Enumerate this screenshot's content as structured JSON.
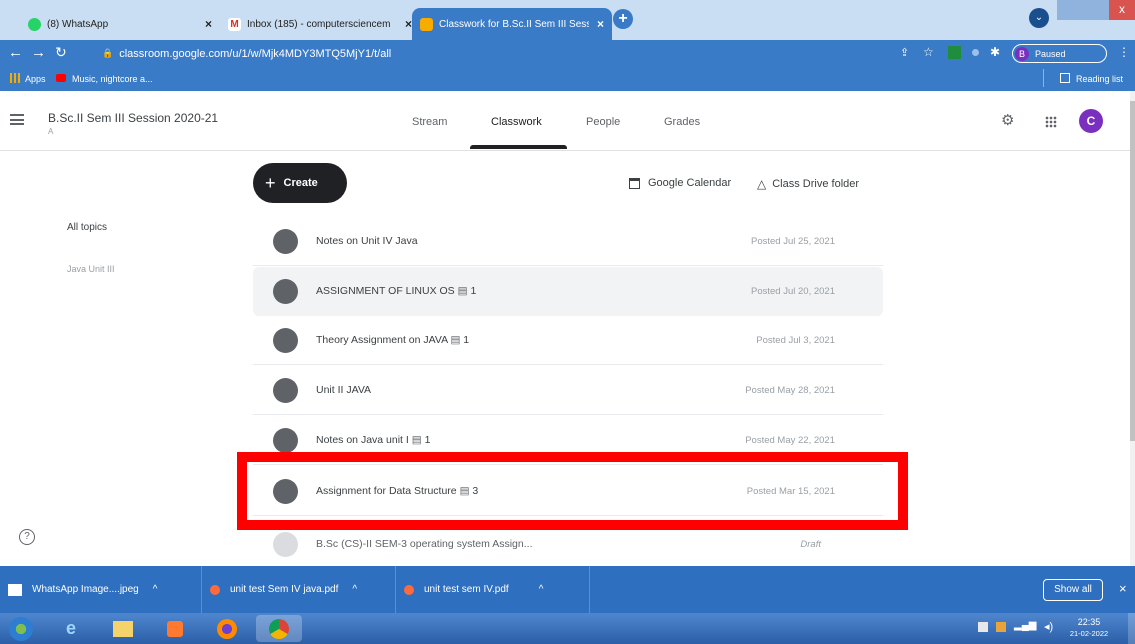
{
  "browser": {
    "tabs": [
      {
        "title": "(8) WhatsApp",
        "active": false
      },
      {
        "title": "Inbox (185) - computersciencem",
        "active": false
      },
      {
        "title": "Classwork for B.Sc.II Sem III Sess",
        "active": true
      }
    ],
    "url": "classroom.google.com/u/1/w/Mjk4MDY3MTQ5MjY1/t/all",
    "profile_label": "Paused",
    "profile_initial": "B",
    "bookmarks": [
      {
        "label": "Apps"
      },
      {
        "label": "Music, nightcore a..."
      }
    ],
    "reading_list": "Reading list"
  },
  "classroom": {
    "class_name": "B.Sc.II Sem III Session 2020-21",
    "section": "A",
    "nav_tabs": [
      "Stream",
      "Classwork",
      "People",
      "Grades"
    ],
    "active_tab": "Classwork",
    "avatar_initial": "C",
    "create_label": "Create",
    "google_calendar": "Google Calendar",
    "class_drive_folder": "Class Drive folder",
    "topics": [
      "All topics",
      "Java Unit III"
    ],
    "items": [
      {
        "title": "Notes on Unit IV Java",
        "comments": "",
        "posted": "Posted Jul 25, 2021",
        "kind": "material"
      },
      {
        "title": "ASSIGNMENT OF LINUX OS",
        "comments": "1",
        "posted": "Posted Jul 20, 2021",
        "kind": "assignment"
      },
      {
        "title": "Theory Assignment on JAVA",
        "comments": "1",
        "posted": "Posted Jul 3, 2021",
        "kind": "assignment"
      },
      {
        "title": "Unit II JAVA",
        "comments": "",
        "posted": "Posted May 28, 2021",
        "kind": "material"
      },
      {
        "title": "Notes on Java unit I",
        "comments": "1",
        "posted": "Posted May 22, 2021",
        "kind": "material"
      },
      {
        "title": "Assignment for Data Structure",
        "comments": "3",
        "posted": "Posted Mar 15, 2021",
        "kind": "assignment"
      },
      {
        "title": "B.Sc (CS)-II SEM-3 operating system Assign...",
        "comments": "",
        "posted": "Draft",
        "kind": "assignment"
      }
    ]
  },
  "downloads": [
    {
      "name": "WhatsApp Image....jpeg"
    },
    {
      "name": "unit test Sem IV java.pdf"
    },
    {
      "name": "unit test sem IV.pdf"
    }
  ],
  "show_all": "Show all",
  "taskbar": {
    "time": "22:35",
    "date": "21-02-2022"
  },
  "colors": {
    "chrome_blue": "#3a7bc8",
    "highlight": "#ff0000",
    "create_bg": "#202124",
    "avatar": "#7b2fbf"
  }
}
